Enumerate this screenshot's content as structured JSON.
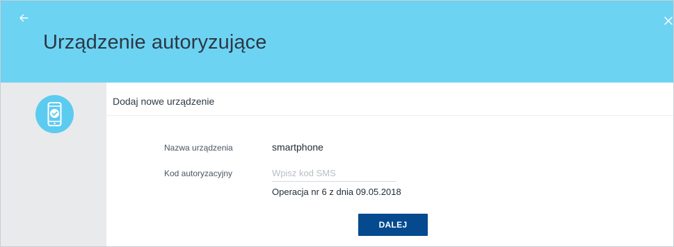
{
  "header": {
    "title": "Urządzenie autoryzujące",
    "back_icon": "arrow-left-icon",
    "close_icon": "close-icon",
    "background_color": "#6dd3f3"
  },
  "sidebar": {
    "icon": "smartphone-check-icon",
    "background_color": "#e9eaeb"
  },
  "form": {
    "section_title": "Dodaj nowe urządzenie",
    "device_name_label": "Nazwa urządzenia",
    "device_name_value": "smartphone",
    "auth_code_label": "Kod autoryzacyjny",
    "auth_code_placeholder": "Wpisz kod SMS",
    "auth_code_value": "",
    "operation_info": "Operacja nr 6 z dnia 09.05.2018",
    "next_button": "DALEJ",
    "button_color": "#054a8f"
  }
}
